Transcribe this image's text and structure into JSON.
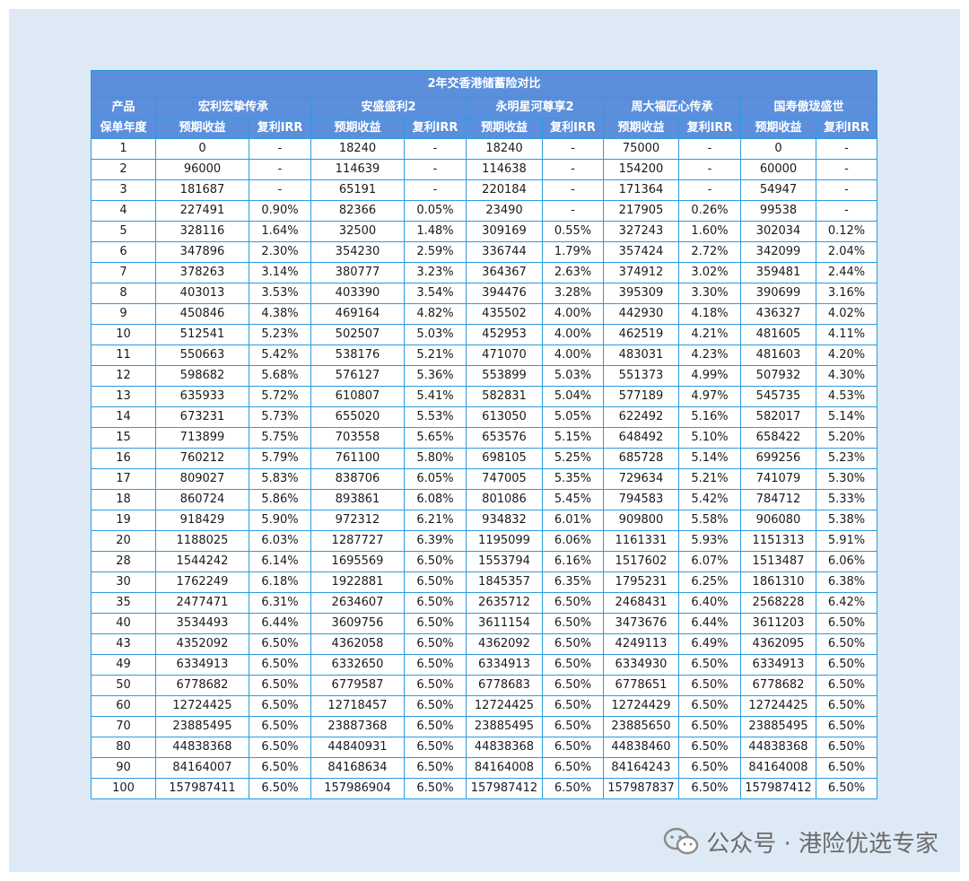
{
  "table": {
    "title": "2年交香港储蓄险对比",
    "product_label": "产品",
    "year_label": "保单年度",
    "products": [
      "宏利宏挚传承",
      "安盛盛利2",
      "永明星河尊享2",
      "周大福匠心传承",
      "国寿傲珑盛世"
    ],
    "col_return": "预期收益",
    "col_irr": "复利IRR",
    "rows": [
      [
        "1",
        "0",
        "-",
        "18240",
        "-",
        "18240",
        "-",
        "75000",
        "-",
        "0",
        "-"
      ],
      [
        "2",
        "96000",
        "-",
        "114639",
        "-",
        "114638",
        "-",
        "154200",
        "-",
        "60000",
        "-"
      ],
      [
        "3",
        "181687",
        "-",
        "65191",
        "-",
        "220184",
        "-",
        "171364",
        "-",
        "54947",
        "-"
      ],
      [
        "4",
        "227491",
        "0.90%",
        "82366",
        "0.05%",
        "23490",
        "-",
        "217905",
        "0.26%",
        "99538",
        "-"
      ],
      [
        "5",
        "328116",
        "1.64%",
        "32500",
        "1.48%",
        "309169",
        "0.55%",
        "327243",
        "1.60%",
        "302034",
        "0.12%"
      ],
      [
        "6",
        "347896",
        "2.30%",
        "354230",
        "2.59%",
        "336744",
        "1.79%",
        "357424",
        "2.72%",
        "342099",
        "2.04%"
      ],
      [
        "7",
        "378263",
        "3.14%",
        "380777",
        "3.23%",
        "364367",
        "2.63%",
        "374912",
        "3.02%",
        "359481",
        "2.44%"
      ],
      [
        "8",
        "403013",
        "3.53%",
        "403390",
        "3.54%",
        "394476",
        "3.28%",
        "395309",
        "3.30%",
        "390699",
        "3.16%"
      ],
      [
        "9",
        "450846",
        "4.38%",
        "469164",
        "4.82%",
        "435502",
        "4.00%",
        "442930",
        "4.18%",
        "436327",
        "4.02%"
      ],
      [
        "10",
        "512541",
        "5.23%",
        "502507",
        "5.03%",
        "452953",
        "4.00%",
        "462519",
        "4.21%",
        "481605",
        "4.11%"
      ],
      [
        "11",
        "550663",
        "5.42%",
        "538176",
        "5.21%",
        "471070",
        "4.00%",
        "483031",
        "4.23%",
        "481603",
        "4.20%"
      ],
      [
        "12",
        "598682",
        "5.68%",
        "576127",
        "5.36%",
        "553899",
        "5.03%",
        "551373",
        "4.99%",
        "507932",
        "4.30%"
      ],
      [
        "13",
        "635933",
        "5.72%",
        "610807",
        "5.41%",
        "582831",
        "5.04%",
        "577189",
        "4.97%",
        "545735",
        "4.53%"
      ],
      [
        "14",
        "673231",
        "5.73%",
        "655020",
        "5.53%",
        "613050",
        "5.05%",
        "622492",
        "5.16%",
        "582017",
        "5.14%"
      ],
      [
        "15",
        "713899",
        "5.75%",
        "703558",
        "5.65%",
        "653576",
        "5.15%",
        "648492",
        "5.10%",
        "658422",
        "5.20%"
      ],
      [
        "16",
        "760212",
        "5.79%",
        "761100",
        "5.80%",
        "698105",
        "5.25%",
        "685728",
        "5.14%",
        "699256",
        "5.23%"
      ],
      [
        "17",
        "809027",
        "5.83%",
        "838706",
        "6.05%",
        "747005",
        "5.35%",
        "729634",
        "5.21%",
        "741079",
        "5.30%"
      ],
      [
        "18",
        "860724",
        "5.86%",
        "893861",
        "6.08%",
        "801086",
        "5.45%",
        "794583",
        "5.42%",
        "784712",
        "5.33%"
      ],
      [
        "19",
        "918429",
        "5.90%",
        "972312",
        "6.21%",
        "934832",
        "6.01%",
        "909800",
        "5.58%",
        "906080",
        "5.38%"
      ],
      [
        "20",
        "1188025",
        "6.03%",
        "1287727",
        "6.39%",
        "1195099",
        "6.06%",
        "1161331",
        "5.93%",
        "1151313",
        "5.91%"
      ],
      [
        "28",
        "1544242",
        "6.14%",
        "1695569",
        "6.50%",
        "1553794",
        "6.16%",
        "1517602",
        "6.07%",
        "1513487",
        "6.06%"
      ],
      [
        "30",
        "1762249",
        "6.18%",
        "1922881",
        "6.50%",
        "1845357",
        "6.35%",
        "1795231",
        "6.25%",
        "1861310",
        "6.38%"
      ],
      [
        "35",
        "2477471",
        "6.31%",
        "2634607",
        "6.50%",
        "2635712",
        "6.50%",
        "2468431",
        "6.40%",
        "2568228",
        "6.42%"
      ],
      [
        "40",
        "3534493",
        "6.44%",
        "3609756",
        "6.50%",
        "3611154",
        "6.50%",
        "3473676",
        "6.44%",
        "3611203",
        "6.50%"
      ],
      [
        "43",
        "4352092",
        "6.50%",
        "4362058",
        "6.50%",
        "4362092",
        "6.50%",
        "4249113",
        "6.49%",
        "4362095",
        "6.50%"
      ],
      [
        "49",
        "6334913",
        "6.50%",
        "6332650",
        "6.50%",
        "6334913",
        "6.50%",
        "6334930",
        "6.50%",
        "6334913",
        "6.50%"
      ],
      [
        "50",
        "6778682",
        "6.50%",
        "6779587",
        "6.50%",
        "6778683",
        "6.50%",
        "6778651",
        "6.50%",
        "6778682",
        "6.50%"
      ],
      [
        "60",
        "12724425",
        "6.50%",
        "12718457",
        "6.50%",
        "12724425",
        "6.50%",
        "12724429",
        "6.50%",
        "12724425",
        "6.50%"
      ],
      [
        "70",
        "23885495",
        "6.50%",
        "23887368",
        "6.50%",
        "23885495",
        "6.50%",
        "23885650",
        "6.50%",
        "23885495",
        "6.50%"
      ],
      [
        "80",
        "44838368",
        "6.50%",
        "44840931",
        "6.50%",
        "44838368",
        "6.50%",
        "44838460",
        "6.50%",
        "44838368",
        "6.50%"
      ],
      [
        "90",
        "84164007",
        "6.50%",
        "84168634",
        "6.50%",
        "84164008",
        "6.50%",
        "84164243",
        "6.50%",
        "84164008",
        "6.50%"
      ],
      [
        "100",
        "157987411",
        "6.50%",
        "157986904",
        "6.50%",
        "157987412",
        "6.50%",
        "157987837",
        "6.50%",
        "157987412",
        "6.50%"
      ]
    ]
  },
  "watermark": {
    "text": "公众号 · 港险优选专家",
    "icon": "wechat-icon"
  },
  "colors": {
    "header_bg": "#5b8fdc",
    "border": "#2d9ae0",
    "panel_bg": "#ddeaf6"
  }
}
